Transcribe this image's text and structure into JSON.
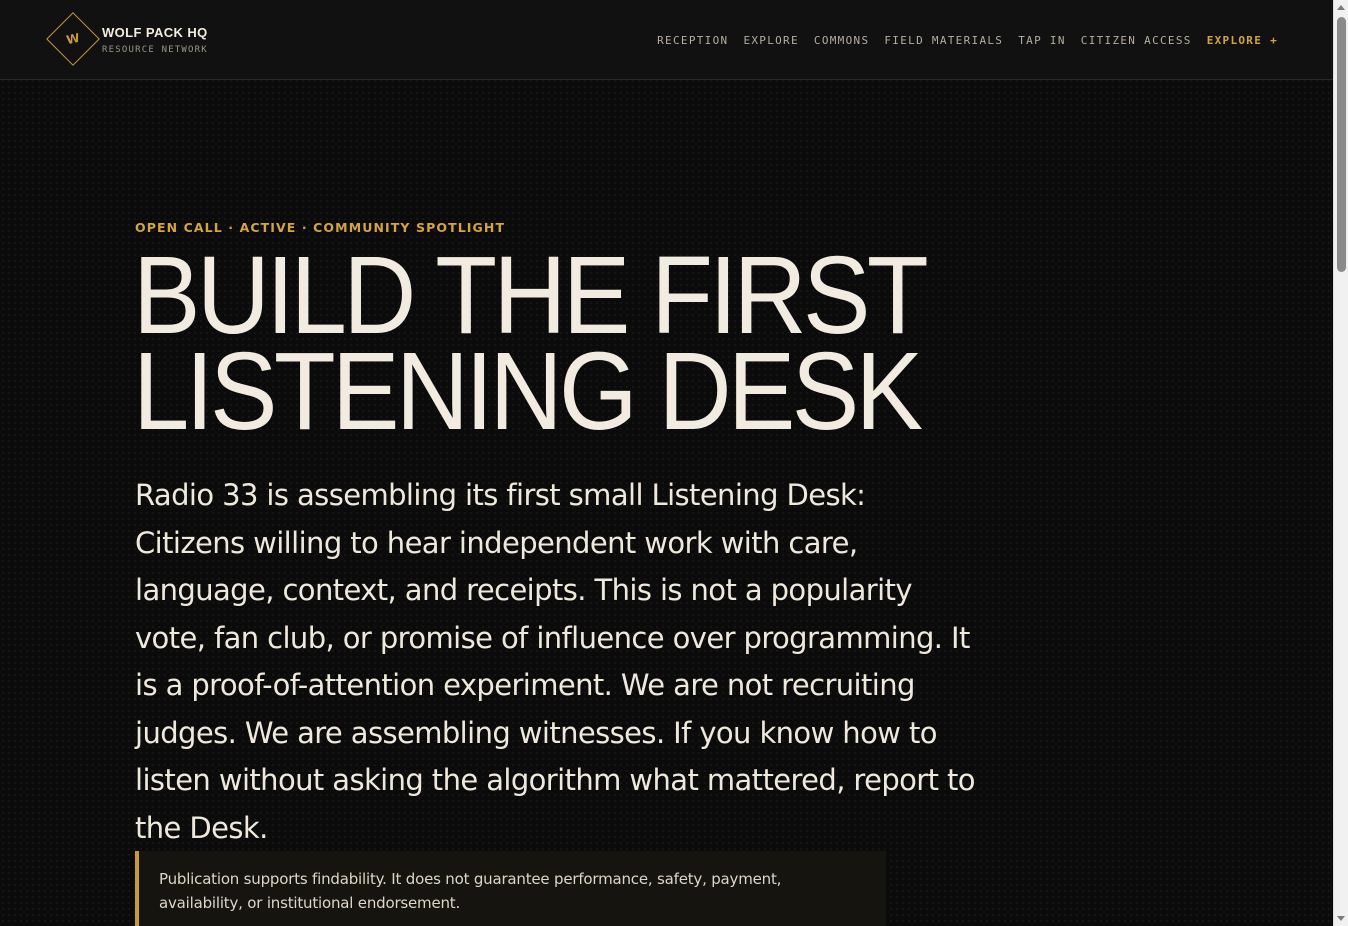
{
  "header": {
    "logo_letter": "W",
    "logo_title": "WOLF PACK HQ",
    "logo_subtitle": "RESOURCE NETWORK",
    "nav": [
      {
        "label": "RECEPTION"
      },
      {
        "label": "EXPLORE"
      },
      {
        "label": "COMMONS"
      },
      {
        "label": "FIELD MATERIALS"
      },
      {
        "label": "TAP IN"
      },
      {
        "label": "CITIZEN ACCESS"
      },
      {
        "label": "EXPLORE +"
      }
    ]
  },
  "hero": {
    "eyebrow": "OPEN CALL · ACTIVE · COMMUNITY SPOTLIGHT",
    "headline_line1": "BUILD THE FIRST",
    "headline_line2": "LISTENING DESK",
    "body": "Radio 33 is assembling its first small Listening Desk: Citizens willing to hear independent work with care, language, context, and receipts. This is not a popularity vote, fan club, or promise of influence over programming. It is a proof-of-attention experiment. We are not recruiting judges. We are assembling witnesses. If you know how to listen without asking the algorithm what mattered, report to the Desk.",
    "notice": "Publication supports findability. It does not guarantee performance, safety, payment, availability, or institutional endorsement."
  },
  "colors": {
    "accent": "#d4a440",
    "background": "#0b0b0b",
    "text": "#f2ece0"
  }
}
